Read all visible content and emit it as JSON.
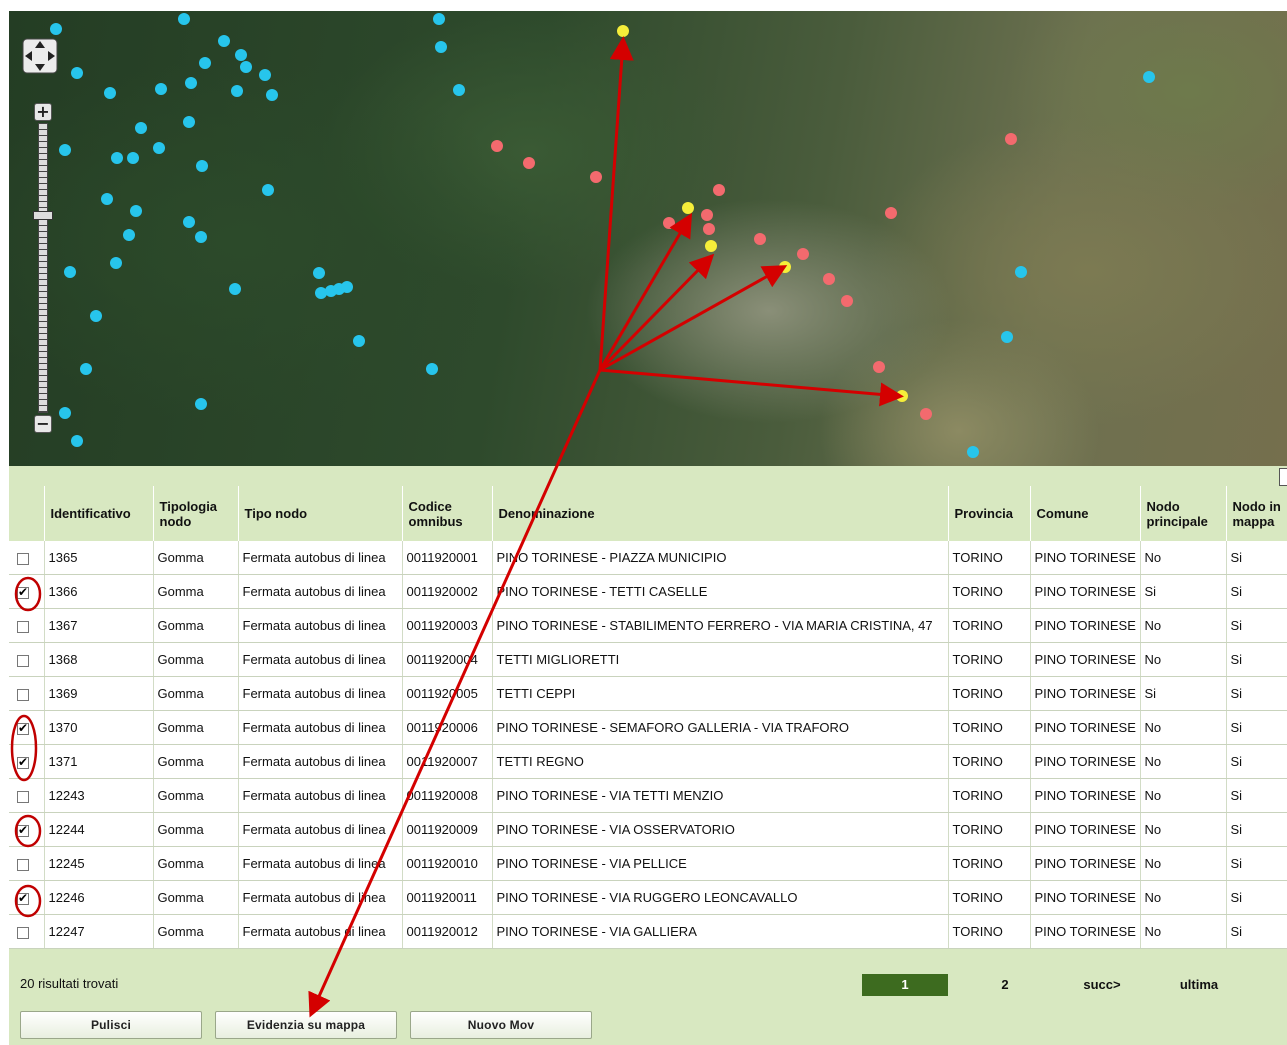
{
  "map": {
    "zoom_in_label": "+",
    "zoom_out_label": "−",
    "collapse_label": "−"
  },
  "table": {
    "columns": [
      "",
      "Identificativo",
      "Tipologia nodo",
      "Tipo nodo",
      "Codice omnibus",
      "Denominazione",
      "Provincia",
      "Comune",
      "Nodo principale",
      "Nodo in mappa"
    ],
    "rows": [
      {
        "checked": false,
        "id": "1365",
        "tipologia": "Gomma",
        "tipo": "Fermata autobus di linea",
        "codice": "0011920001",
        "denominazione": "PINO TORINESE - PIAZZA MUNICIPIO",
        "provincia": "TORINO",
        "comune": "PINO TORINESE",
        "principale": "No",
        "mappa": "Si"
      },
      {
        "checked": true,
        "id": "1366",
        "tipologia": "Gomma",
        "tipo": "Fermata autobus di linea",
        "codice": "0011920002",
        "denominazione": "PINO TORINESE - TETTI CASELLE",
        "provincia": "TORINO",
        "comune": "PINO TORINESE",
        "principale": "Si",
        "mappa": "Si"
      },
      {
        "checked": false,
        "id": "1367",
        "tipologia": "Gomma",
        "tipo": "Fermata autobus di linea",
        "codice": "0011920003",
        "denominazione": "PINO TORINESE - STABILIMENTO FERRERO - VIA MARIA CRISTINA, 47",
        "provincia": "TORINO",
        "comune": "PINO TORINESE",
        "principale": "No",
        "mappa": "Si"
      },
      {
        "checked": false,
        "id": "1368",
        "tipologia": "Gomma",
        "tipo": "Fermata autobus di linea",
        "codice": "0011920004",
        "denominazione": "TETTI MIGLIORETTI",
        "provincia": "TORINO",
        "comune": "PINO TORINESE",
        "principale": "No",
        "mappa": "Si"
      },
      {
        "checked": false,
        "id": "1369",
        "tipologia": "Gomma",
        "tipo": "Fermata autobus di linea",
        "codice": "0011920005",
        "denominazione": "TETTI CEPPI",
        "provincia": "TORINO",
        "comune": "PINO TORINESE",
        "principale": "Si",
        "mappa": "Si"
      },
      {
        "checked": true,
        "id": "1370",
        "tipologia": "Gomma",
        "tipo": "Fermata autobus di linea",
        "codice": "0011920006",
        "denominazione": "PINO TORINESE - SEMAFORO GALLERIA - VIA TRAFORO",
        "provincia": "TORINO",
        "comune": "PINO TORINESE",
        "principale": "No",
        "mappa": "Si"
      },
      {
        "checked": true,
        "id": "1371",
        "tipologia": "Gomma",
        "tipo": "Fermata autobus di linea",
        "codice": "0011920007",
        "denominazione": "TETTI REGNO",
        "provincia": "TORINO",
        "comune": "PINO TORINESE",
        "principale": "No",
        "mappa": "Si"
      },
      {
        "checked": false,
        "id": "12243",
        "tipologia": "Gomma",
        "tipo": "Fermata autobus di linea",
        "codice": "0011920008",
        "denominazione": "PINO TORINESE - VIA TETTI MENZIO",
        "provincia": "TORINO",
        "comune": "PINO TORINESE",
        "principale": "No",
        "mappa": "Si"
      },
      {
        "checked": true,
        "id": "12244",
        "tipologia": "Gomma",
        "tipo": "Fermata autobus di linea",
        "codice": "0011920009",
        "denominazione": "PINO TORINESE - VIA OSSERVATORIO",
        "provincia": "TORINO",
        "comune": "PINO TORINESE",
        "principale": "No",
        "mappa": "Si"
      },
      {
        "checked": false,
        "id": "12245",
        "tipologia": "Gomma",
        "tipo": "Fermata autobus di linea",
        "codice": "0011920010",
        "denominazione": "PINO TORINESE - VIA PELLICE",
        "provincia": "TORINO",
        "comune": "PINO TORINESE",
        "principale": "No",
        "mappa": "Si"
      },
      {
        "checked": true,
        "id": "12246",
        "tipologia": "Gomma",
        "tipo": "Fermata autobus di linea",
        "codice": "0011920011",
        "denominazione": "PINO TORINESE - VIA RUGGERO LEONCAVALLO",
        "provincia": "TORINO",
        "comune": "PINO TORINESE",
        "principale": "No",
        "mappa": "Si"
      },
      {
        "checked": false,
        "id": "12247",
        "tipologia": "Gomma",
        "tipo": "Fermata autobus di linea",
        "codice": "0011920012",
        "denominazione": "PINO TORINESE - VIA GALLIERA",
        "provincia": "TORINO",
        "comune": "PINO TORINESE",
        "principale": "No",
        "mappa": "Si"
      }
    ]
  },
  "footer": {
    "results": "20 risultati trovati",
    "pages": [
      "1",
      "2"
    ],
    "next": "succ>",
    "last": "ultima"
  },
  "buttons": {
    "clear": "Pulisci",
    "highlight": "Evidenzia su mappa",
    "new": "Nuovo Mov"
  },
  "colors": {
    "accent": "#3d6b1f",
    "grid_bg": "#d8e8c1",
    "marker_cyan": "#27c5ec",
    "marker_pink": "#f36a6e",
    "marker_yellow": "#f5ee3a",
    "annotation": "#d40000"
  }
}
